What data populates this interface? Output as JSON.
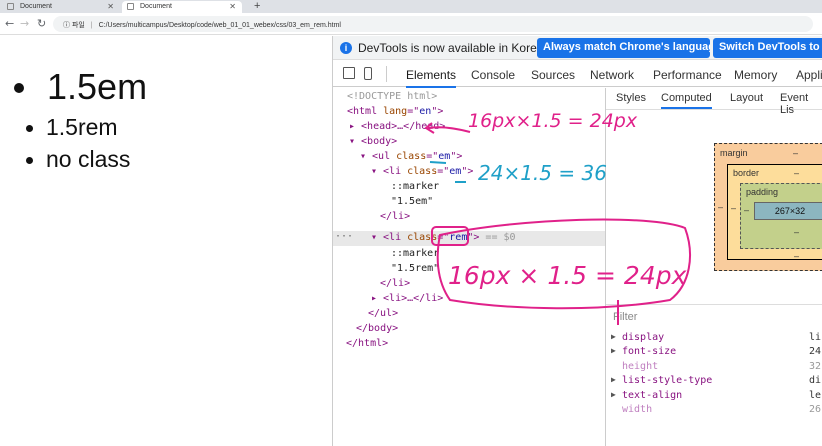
{
  "browser": {
    "tabs": [
      {
        "title": "Document",
        "active": false
      },
      {
        "title": "Document",
        "active": true
      }
    ],
    "new_tab_glyph": "+",
    "address": {
      "scheme_label": "파일",
      "url": "C:/Users/multicampus/Desktop/code/web_01_01_webex/css/03_em_rem.html"
    }
  },
  "page": {
    "items": [
      {
        "label": "1.5em"
      },
      {
        "label": "1.5rem"
      },
      {
        "label": "no class"
      }
    ]
  },
  "devtools": {
    "infobar": {
      "message": "DevTools is now available in Korean!",
      "match_button": "Always match Chrome's language",
      "switch_button": "Switch DevTools to Ko"
    },
    "tabs": [
      "Elements",
      "Console",
      "Sources",
      "Network",
      "Performance",
      "Memory",
      "Appli"
    ],
    "active_tab": "Elements",
    "styles_tabs": [
      "Styles",
      "Computed",
      "Layout",
      "Event Lis"
    ],
    "active_styles_tab": "Computed",
    "dom": [
      {
        "indent": 0,
        "html": "<!DOCTYPE html>",
        "kind": "comment"
      },
      {
        "indent": 0,
        "tag": "html",
        "attr": "lang",
        "val": "en"
      },
      {
        "indent": 1,
        "tag": "head",
        "collapsed": true
      },
      {
        "indent": 1,
        "tag": "body"
      },
      {
        "indent": 2,
        "tag": "ul",
        "attr": "class",
        "val": "em"
      },
      {
        "indent": 3,
        "tag": "li",
        "attr": "class",
        "val": "em"
      },
      {
        "indent": 4,
        "text": "::marker"
      },
      {
        "indent": 4,
        "text": "\"1.5em\""
      },
      {
        "indent": 3,
        "close": "li"
      },
      {
        "indent": 3,
        "tag": "li",
        "attr": "class",
        "val": "rem",
        "selected": true,
        "suffix": "== $0"
      },
      {
        "indent": 4,
        "text": "::marker"
      },
      {
        "indent": 4,
        "text": "\"1.5rem\""
      },
      {
        "indent": 3,
        "close": "li"
      },
      {
        "indent": 3,
        "tag": "li",
        "collapsed": true
      },
      {
        "indent": 2,
        "close": "ul"
      },
      {
        "indent": 1,
        "close": "body"
      },
      {
        "indent": 0,
        "close": "html"
      }
    ],
    "box_model": {
      "margin_label": "margin",
      "border_label": "border",
      "padding_label": "padding",
      "content_size": "267×32",
      "dash": "–"
    },
    "filter_placeholder": "Filter",
    "computed": [
      {
        "name": "display",
        "value": "li",
        "inherited": false
      },
      {
        "name": "font-size",
        "value": "24",
        "inherited": false
      },
      {
        "name": "height",
        "value": "32",
        "inherited": true
      },
      {
        "name": "list-style-type",
        "value": "di",
        "inherited": false
      },
      {
        "name": "text-align",
        "value": "le",
        "inherited": false
      },
      {
        "name": "width",
        "value": "26",
        "inherited": true
      }
    ]
  },
  "annotations": {
    "color": "#e0218a",
    "blue": "#1fa0c8",
    "notes": [
      "16px×1.5 = 24px",
      "24×1.5 = 36",
      "16px × 1.5 = 24px"
    ]
  }
}
